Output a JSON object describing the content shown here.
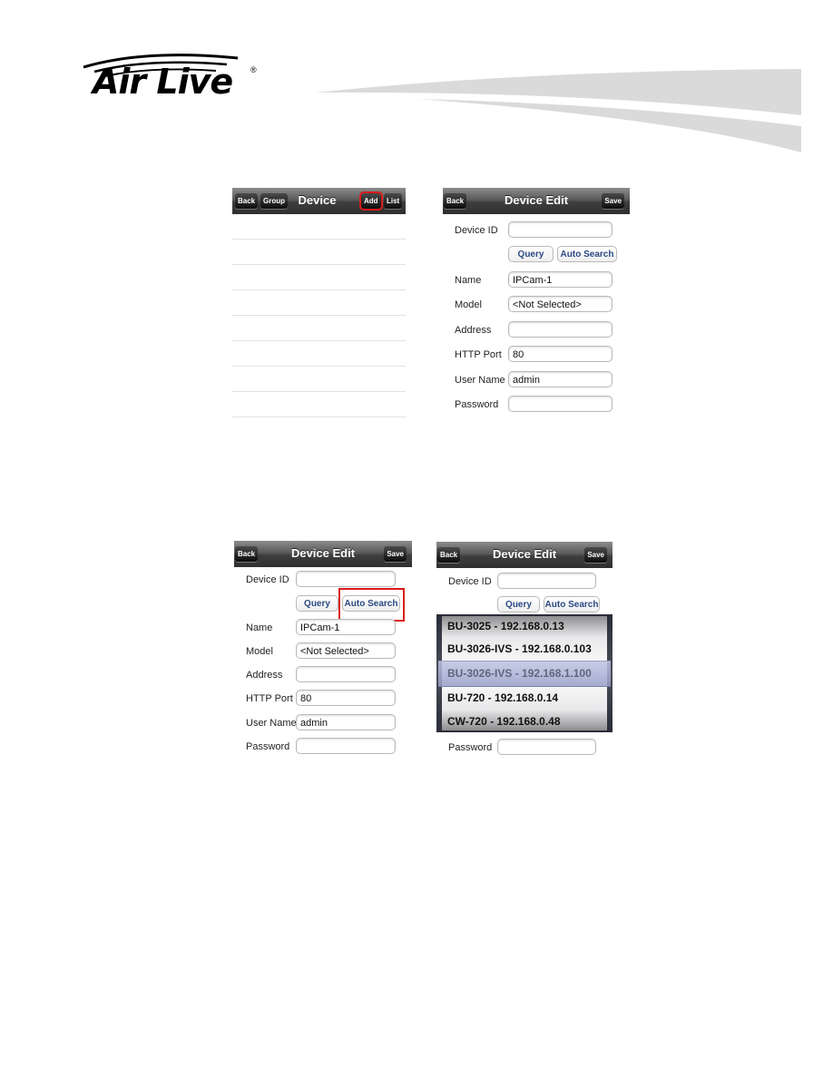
{
  "brand": {
    "logo_text": "Air Live",
    "registered": "®"
  },
  "screens": [
    {
      "id": "device-list",
      "nav": {
        "title": "Device",
        "back": "Back",
        "group": "Group",
        "add": "Add",
        "list": "List"
      },
      "rows": 8,
      "highlight": "add-button"
    },
    {
      "id": "device-edit",
      "nav": {
        "title": "Device Edit",
        "back": "Back",
        "save": "Save"
      },
      "fields": {
        "device_id": {
          "label": "Device ID",
          "value": ""
        },
        "name": {
          "label": "Name",
          "value": "IPCam-1"
        },
        "model": {
          "label": "Model",
          "value": "<Not Selected>"
        },
        "address": {
          "label": "Address",
          "value": ""
        },
        "http_port": {
          "label": "HTTP Port",
          "value": "80"
        },
        "user_name": {
          "label": "User Name",
          "value": "admin"
        },
        "password": {
          "label": "Password",
          "value": ""
        }
      },
      "buttons": {
        "query": "Query",
        "auto_search": "Auto Search"
      }
    },
    {
      "id": "device-edit-highlight",
      "nav": {
        "title": "Device Edit",
        "back": "Back",
        "save": "Save"
      },
      "fields": {
        "device_id": {
          "label": "Device ID",
          "value": ""
        },
        "name": {
          "label": "Name",
          "value": "IPCam-1"
        },
        "model": {
          "label": "Model",
          "value": "<Not Selected>"
        },
        "address": {
          "label": "Address",
          "value": ""
        },
        "http_port": {
          "label": "HTTP Port",
          "value": "80"
        },
        "user_name": {
          "label": "User Name",
          "value": "admin"
        },
        "password": {
          "label": "Password",
          "value": ""
        }
      },
      "buttons": {
        "query": "Query",
        "auto_search": "Auto Search"
      },
      "highlight": "auto-search-button"
    },
    {
      "id": "device-edit-picker",
      "nav": {
        "title": "Device Edit",
        "back": "Back",
        "save": "Save"
      },
      "fields": {
        "device_id": {
          "label": "Device ID",
          "value": ""
        },
        "password": {
          "label": "Password",
          "value": ""
        }
      },
      "buttons": {
        "query": "Query",
        "auto_search": "Auto Search"
      },
      "picker": {
        "items": [
          "BU-3025 - 192.168.0.13",
          "BU-3026-IVS - 192.168.0.103",
          "BU-3026-IVS - 192.168.1.100",
          "BU-720 - 192.168.0.14",
          "CW-720 - 192.168.0.48"
        ],
        "selected_index": 2
      }
    }
  ]
}
